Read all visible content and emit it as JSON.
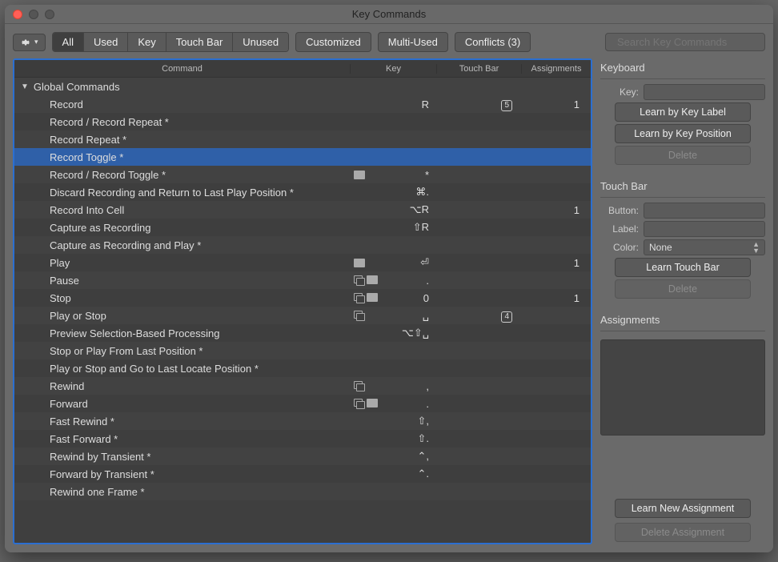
{
  "window": {
    "title": "Key Commands"
  },
  "toolbar": {
    "seg1": [
      "All",
      "Used",
      "Key",
      "Touch Bar",
      "Unused"
    ],
    "seg1_active": 0,
    "pills": [
      "Customized",
      "Multi-Used",
      "Conflicts (3)"
    ],
    "search_placeholder": "Search Key Commands"
  },
  "columns": {
    "command": "Command",
    "key": "Key",
    "touchbar": "Touch Bar",
    "assignments": "Assignments"
  },
  "group": "Global Commands",
  "rows": [
    {
      "cmd": "Record",
      "key": "R",
      "tb": "5",
      "asg": "1",
      "icons": []
    },
    {
      "cmd": "Record / Record Repeat *",
      "key": "",
      "tb": "",
      "asg": "",
      "icons": []
    },
    {
      "cmd": "Record Repeat *",
      "key": "",
      "tb": "",
      "asg": "",
      "icons": []
    },
    {
      "cmd": "Record Toggle *",
      "key": "",
      "tb": "",
      "asg": "",
      "icons": [],
      "selected": true
    },
    {
      "cmd": "Record / Record Toggle *",
      "key": "*",
      "tb": "",
      "asg": "",
      "icons": [
        "keeb"
      ]
    },
    {
      "cmd": "Discard Recording and Return to Last Play Position *",
      "key": "⌘.",
      "tb": "",
      "asg": "",
      "icons": []
    },
    {
      "cmd": "Record Into Cell",
      "key": "⌥R",
      "tb": "",
      "asg": "1",
      "icons": []
    },
    {
      "cmd": "Capture as Recording",
      "key": "⇧R",
      "tb": "",
      "asg": "",
      "icons": []
    },
    {
      "cmd": "Capture as Recording and Play *",
      "key": "",
      "tb": "",
      "asg": "",
      "icons": []
    },
    {
      "cmd": "Play",
      "key": "⏎",
      "tb": "",
      "asg": "1",
      "icons": [
        "keeb"
      ]
    },
    {
      "cmd": "Pause",
      "key": ".",
      "tb": "",
      "asg": "",
      "icons": [
        "copy",
        "keeb"
      ]
    },
    {
      "cmd": "Stop",
      "key": "0",
      "tb": "",
      "asg": "1",
      "icons": [
        "copy",
        "keeb"
      ]
    },
    {
      "cmd": "Play or Stop",
      "key": "␣",
      "tb": "4",
      "asg": "",
      "icons": [
        "copy"
      ]
    },
    {
      "cmd": "Preview Selection-Based Processing",
      "key": "⌥⇧␣",
      "tb": "",
      "asg": "",
      "icons": []
    },
    {
      "cmd": "Stop or Play From Last Position *",
      "key": "",
      "tb": "",
      "asg": "",
      "icons": []
    },
    {
      "cmd": "Play or Stop and Go to Last Locate Position *",
      "key": "",
      "tb": "",
      "asg": "",
      "icons": []
    },
    {
      "cmd": "Rewind",
      "key": ",",
      "tb": "",
      "asg": "",
      "icons": [
        "copy"
      ]
    },
    {
      "cmd": "Forward",
      "key": ".",
      "tb": "",
      "asg": "",
      "icons": [
        "copy",
        "keeb"
      ]
    },
    {
      "cmd": "Fast Rewind *",
      "key": "⇧,",
      "tb": "",
      "asg": "",
      "icons": []
    },
    {
      "cmd": "Fast Forward *",
      "key": "⇧.",
      "tb": "",
      "asg": "",
      "icons": []
    },
    {
      "cmd": "Rewind by Transient *",
      "key": "⌃,",
      "tb": "",
      "asg": "",
      "icons": []
    },
    {
      "cmd": "Forward by Transient *",
      "key": "⌃.",
      "tb": "",
      "asg": "",
      "icons": []
    },
    {
      "cmd": "Rewind one Frame *",
      "key": "",
      "tb": "",
      "asg": "",
      "icons": []
    }
  ],
  "side": {
    "keyboard": {
      "title": "Keyboard",
      "key_label": "Key:",
      "learn_label": "Learn by Key Label",
      "learn_pos": "Learn by Key Position",
      "delete": "Delete"
    },
    "touchbar": {
      "title": "Touch Bar",
      "button_label": "Button:",
      "label_label": "Label:",
      "color_label": "Color:",
      "color_value": "None",
      "learn": "Learn Touch Bar",
      "delete": "Delete"
    },
    "assignments": {
      "title": "Assignments",
      "learn": "Learn New Assignment",
      "delete": "Delete Assignment"
    }
  }
}
